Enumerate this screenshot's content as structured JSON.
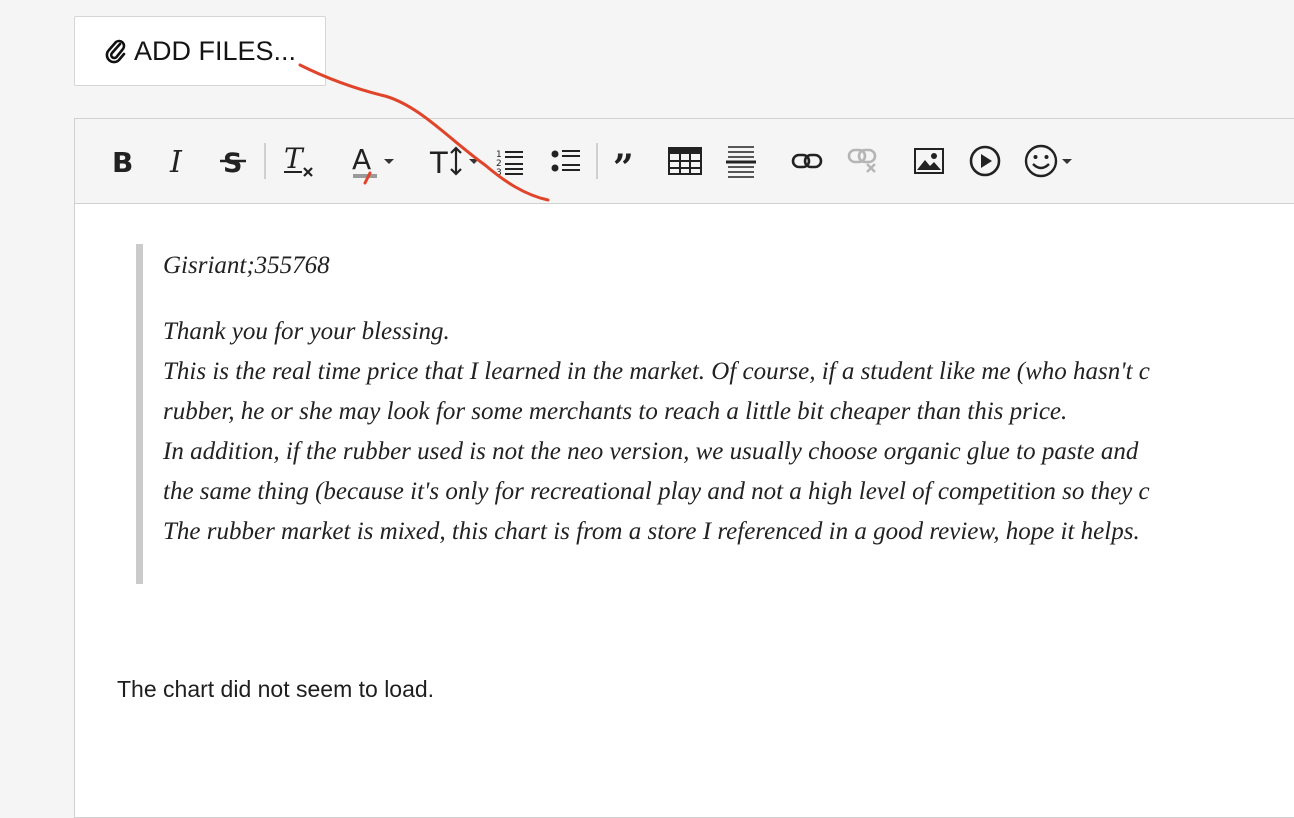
{
  "add_files": {
    "label": "ADD FILES...",
    "icon": "paperclip-icon"
  },
  "toolbar": {
    "buttons": [
      {
        "name": "bold-button",
        "icon": "bold-icon"
      },
      {
        "name": "italic-button",
        "icon": "italic-icon"
      },
      {
        "name": "strikethrough-button",
        "icon": "strikethrough-icon"
      },
      {
        "name": "clear-formatting-button",
        "icon": "clear-formatting-icon"
      },
      {
        "name": "text-color-button",
        "icon": "text-color-icon"
      },
      {
        "name": "font-size-button",
        "icon": "font-size-icon"
      },
      {
        "name": "ordered-list-button",
        "icon": "ordered-list-icon"
      },
      {
        "name": "unordered-list-button",
        "icon": "unordered-list-icon"
      },
      {
        "name": "blockquote-button",
        "icon": "quote-icon"
      },
      {
        "name": "table-button",
        "icon": "table-icon"
      },
      {
        "name": "horizontal-rule-button",
        "icon": "horizontal-rule-icon"
      },
      {
        "name": "link-button",
        "icon": "link-icon"
      },
      {
        "name": "unlink-button",
        "icon": "unlink-icon",
        "disabled": true
      },
      {
        "name": "image-button",
        "icon": "image-icon"
      },
      {
        "name": "video-button",
        "icon": "play-icon"
      },
      {
        "name": "emoji-button",
        "icon": "smiley-icon"
      }
    ]
  },
  "quote": {
    "author": "Gisriant;355768",
    "lines": [
      "Thank you for your blessing.",
      "This is the real time price that I learned in the market. Of course, if a student like me (who hasn't c",
      "rubber, he or she may look for some merchants to reach a little bit cheaper than this price.",
      "In addition, if the rubber used is not the neo version, we usually choose organic glue to paste and",
      "the same thing (because it's only for recreational play and not a high level of competition so they c",
      "The rubber market is mixed, this chart is from a store I referenced in a good review, hope it helps."
    ]
  },
  "reply_text": "The chart did not seem to load.",
  "colors": {
    "annotation_stroke": "#e0452b",
    "quote_border": "#cbcbcb",
    "toolbar_bg": "#f5f5f5"
  }
}
